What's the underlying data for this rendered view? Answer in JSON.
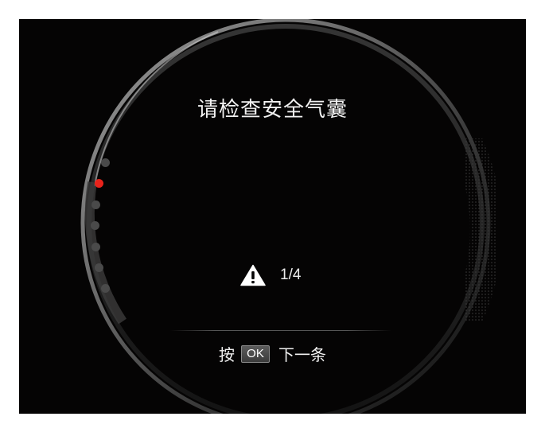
{
  "screen": {
    "title": "请检查安全气囊",
    "counter": "1/4",
    "hint": {
      "prefix": "按",
      "key": "OK",
      "suffix": "下一条"
    },
    "page_indicator": {
      "total": 7,
      "active_index": 1
    }
  },
  "icons": {
    "warning": "warning-triangle-icon"
  },
  "colors": {
    "background": "#050404",
    "active_dot": "#e8231b",
    "inactive_dot": "#4a4a4a",
    "text": "#f2f2f2"
  }
}
